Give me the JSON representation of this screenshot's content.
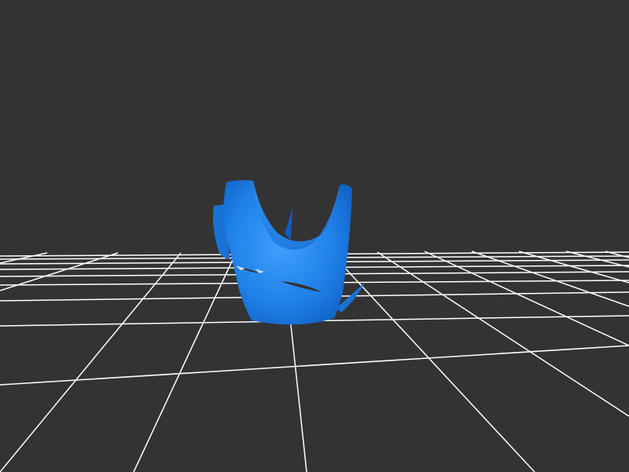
{
  "viewport": {
    "background_color": "#333333",
    "grid_color": "#ffffff",
    "model_color": "#1e7fe6",
    "model_highlight_color": "#3fa0ff",
    "model_shadow_color": "#0f5cc0",
    "show_grid": true
  }
}
